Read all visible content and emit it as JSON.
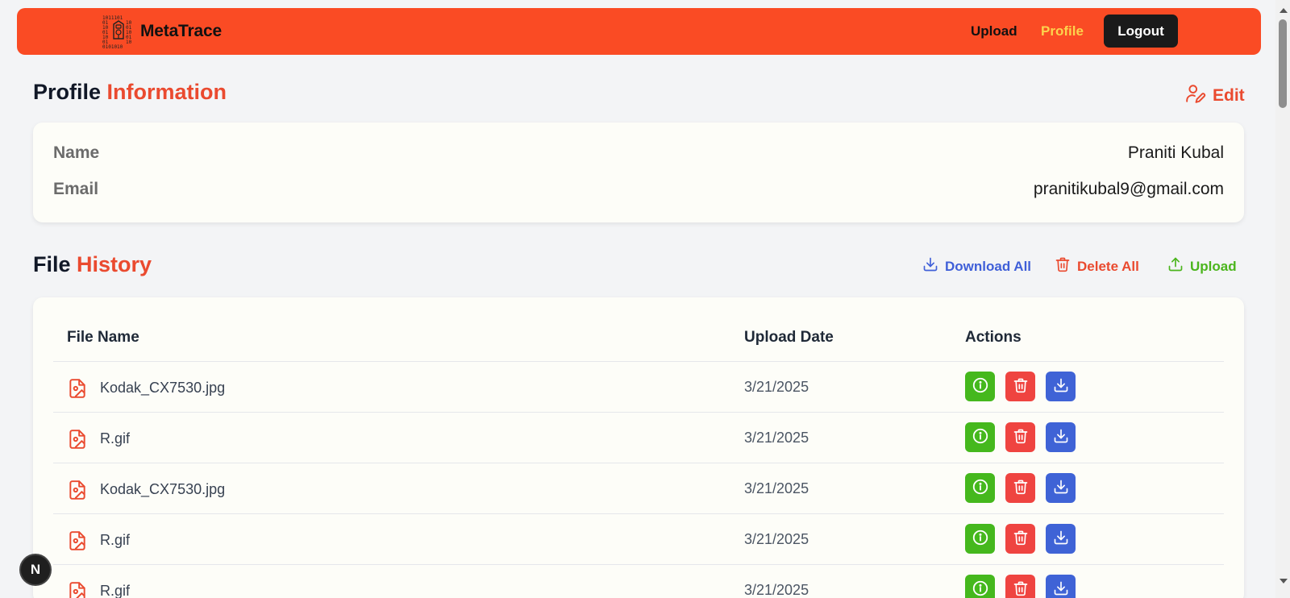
{
  "brand": {
    "name": "MetaTrace",
    "accent_color": "#fa4b24"
  },
  "nav": {
    "upload": "Upload",
    "profile": "Profile",
    "logout": "Logout"
  },
  "profile": {
    "title_main": "Profile",
    "title_accent": "Information",
    "edit_label": "Edit",
    "fields": [
      {
        "label": "Name",
        "value": "Praniti Kubal"
      },
      {
        "label": "Email",
        "value": "pranitikubal9@gmail.com"
      }
    ]
  },
  "history": {
    "title_main": "File",
    "title_accent": "History",
    "actions": {
      "download_all": "Download All",
      "delete_all": "Delete All",
      "upload": "Upload"
    },
    "columns": [
      "File Name",
      "Upload Date",
      "Actions"
    ],
    "rows": [
      {
        "name": "Kodak_CX7530.jpg",
        "date": "3/21/2025"
      },
      {
        "name": "R.gif",
        "date": "3/21/2025"
      },
      {
        "name": "Kodak_CX7530.jpg",
        "date": "3/21/2025"
      },
      {
        "name": "R.gif",
        "date": "3/21/2025"
      },
      {
        "name": "R.gif",
        "date": "3/21/2025"
      }
    ]
  },
  "icons": {
    "file": "file-image-icon",
    "info": "info-icon",
    "delete": "trash-icon",
    "download": "download-icon",
    "edit": "user-edit-icon"
  },
  "colors": {
    "info": "#45b81d",
    "delete": "#ef4440",
    "download": "#3f63d6",
    "accent": "#ea4a2f"
  },
  "dev_badge": "N"
}
